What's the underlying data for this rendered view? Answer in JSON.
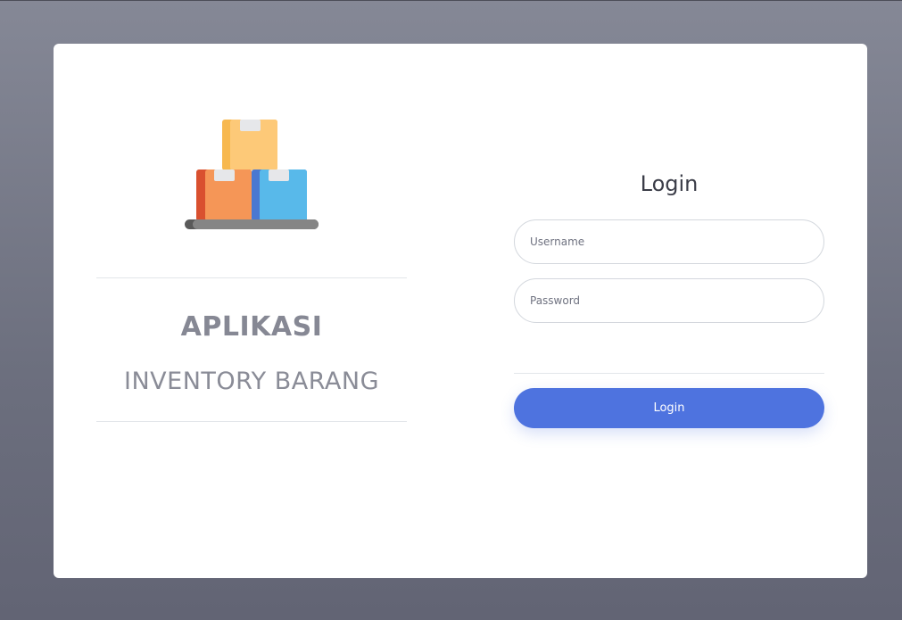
{
  "branding": {
    "title": "APLIKASI",
    "subtitle": "INVENTORY BARANG",
    "logo_icon": "boxes-stack-icon"
  },
  "login": {
    "heading": "Login",
    "username_placeholder": "Username",
    "username_value": "",
    "password_placeholder": "Password",
    "password_value": "",
    "submit_label": "Login"
  },
  "colors": {
    "accent": "#4e73df",
    "background": "#6c6f7e",
    "card": "#ffffff",
    "title_text": "#868894"
  }
}
